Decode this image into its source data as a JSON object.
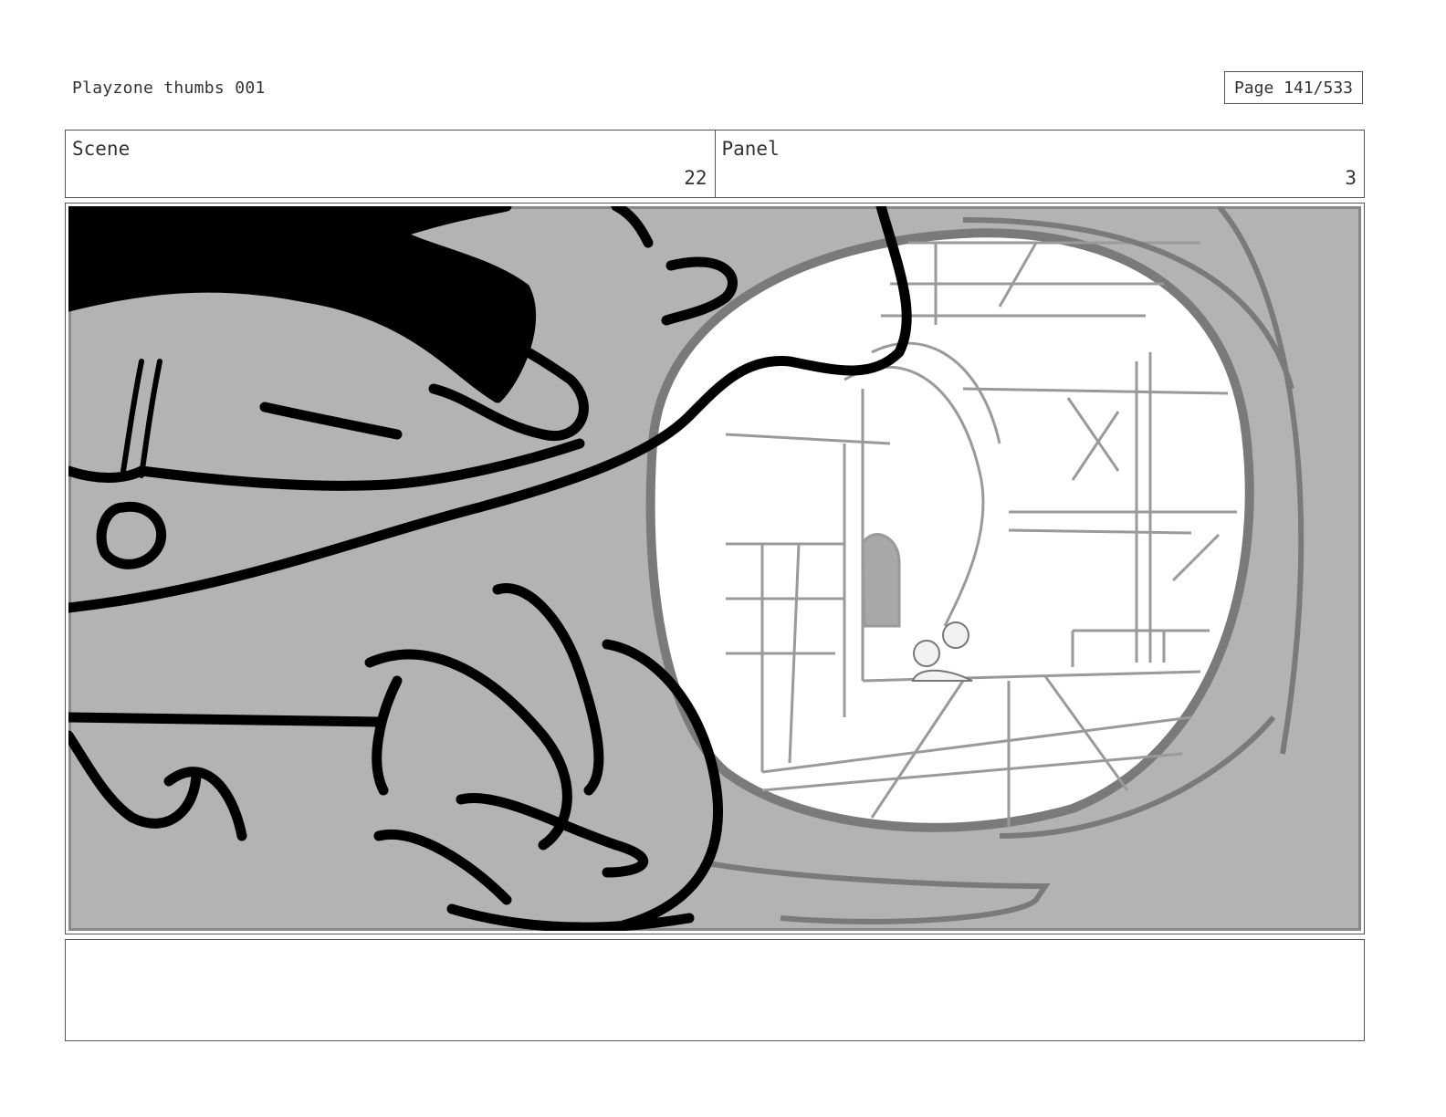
{
  "header": {
    "title": "Playzone thumbs 001",
    "page": "Page 141/533"
  },
  "info": {
    "scene_label": "Scene",
    "scene_value": "22",
    "panel_label": "Panel",
    "panel_value": "3"
  },
  "notes": {
    "text": ""
  }
}
